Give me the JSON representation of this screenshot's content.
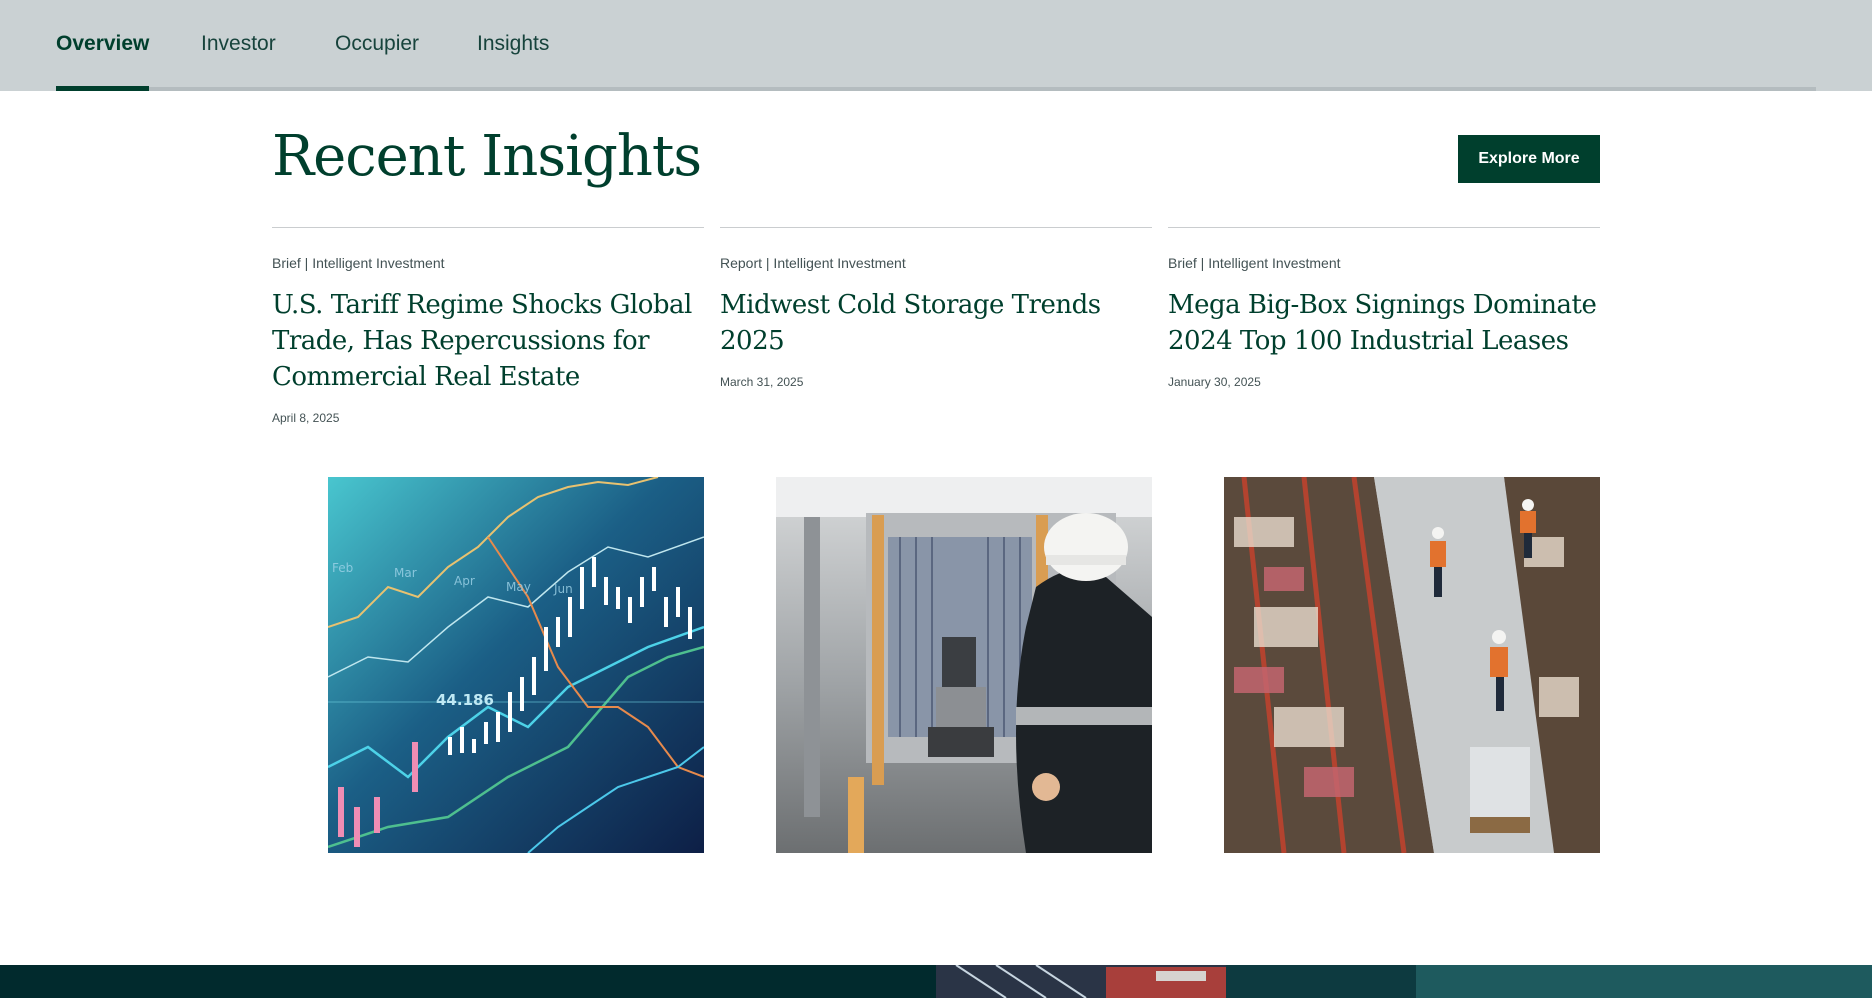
{
  "tabs": [
    {
      "label": "Overview",
      "active": true
    },
    {
      "label": "Investor",
      "active": false
    },
    {
      "label": "Occupier",
      "active": false
    },
    {
      "label": "Insights",
      "active": false
    }
  ],
  "section": {
    "title": "Recent Insights",
    "explore_label": "Explore More"
  },
  "cards": [
    {
      "kicker": "Brief | Intelligent Investment",
      "headline": "U.S. Tariff Regime Shocks Global Trade, Has Repercussions for Commercial Real Estate",
      "date": "April 8, 2025",
      "image": "financial-chart-image"
    },
    {
      "kicker": "Report | Intelligent Investment",
      "headline": "Midwest Cold Storage Trends 2025",
      "date": "March 31, 2025",
      "image": "cold-storage-forklift-image"
    },
    {
      "kicker": "Brief | Intelligent Investment",
      "headline": "Mega Big-Box Signings Dominate 2024 Top 100 Industrial Leases",
      "date": "January 30, 2025",
      "image": "warehouse-aisle-image"
    }
  ],
  "image_text": {
    "months": [
      "Feb",
      "Mar",
      "Apr",
      "May",
      "Jun"
    ],
    "value": "44.186"
  },
  "colors": {
    "brand_green": "#003f2d",
    "tabbar_bg": "#cad1d3",
    "footer_bg": "#012a2d"
  }
}
